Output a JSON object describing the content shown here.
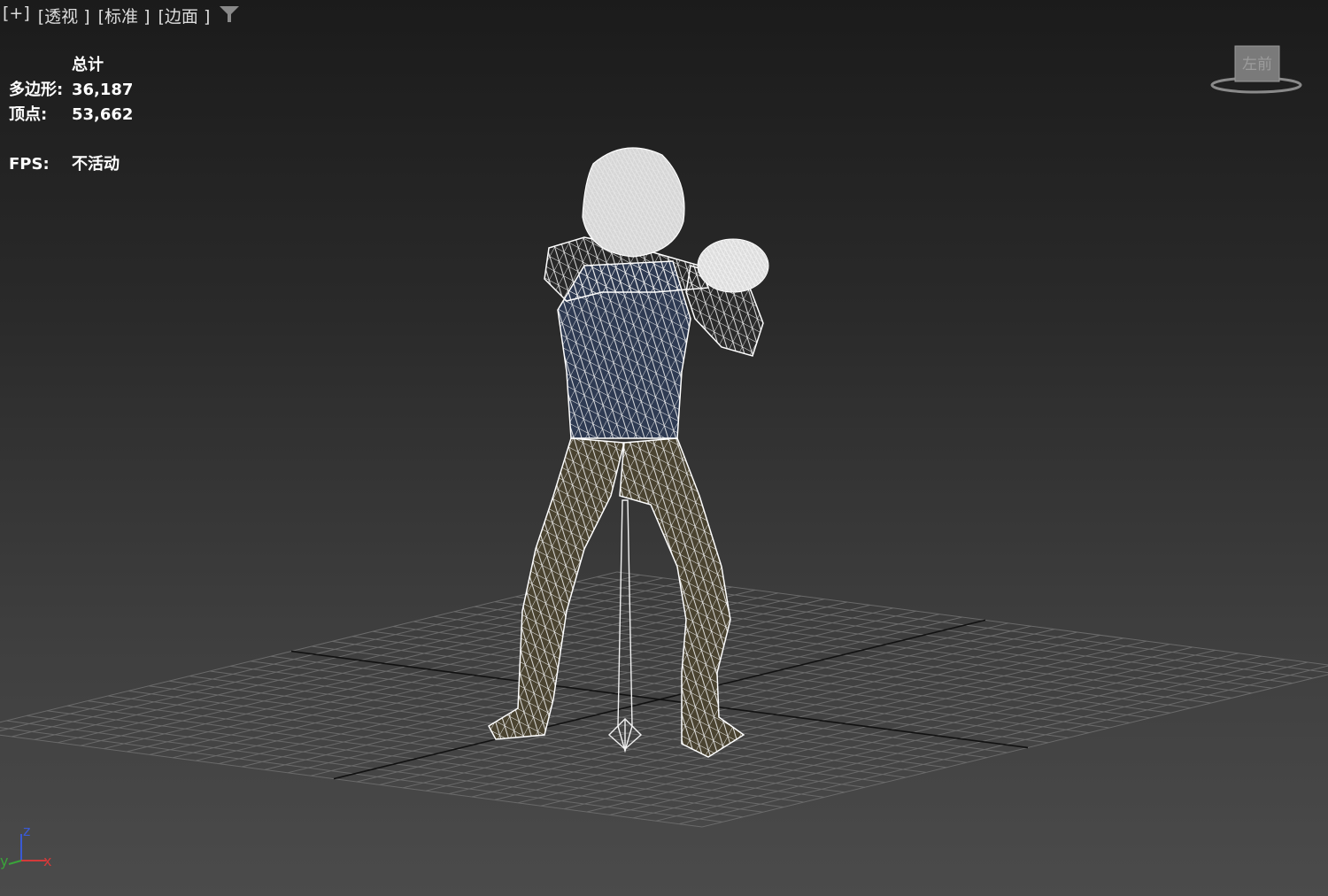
{
  "viewport_menu": {
    "plus_label": "[+]",
    "view_label": "[透视 ]",
    "shading_label": "[标准 ]",
    "display_label": "[边面 ]"
  },
  "filter_icon": "funnel-icon",
  "stats": {
    "header": "总计",
    "polygons_label": "多边形:",
    "polygons_value": "36,187",
    "vertices_label": "顶点:",
    "vertices_value": "53,662",
    "fps_label": "FPS:",
    "fps_value": "不活动"
  },
  "viewcube": {
    "face_label": "左前"
  },
  "axis_tripod": {
    "z_label": "z",
    "y_label": "y",
    "x_label": "x"
  },
  "colors": {
    "background_top": "#1b1b1b",
    "background_bottom": "#4b4b4b",
    "grid": "#6a6a6a",
    "axis_line": "#111111",
    "wireframe": "#f2f2f2",
    "torso": "#2e3a52",
    "legs": "#4a4330",
    "x_axis": "#d43a3a",
    "y_axis": "#3aa43a",
    "z_axis": "#3a5ad4"
  }
}
